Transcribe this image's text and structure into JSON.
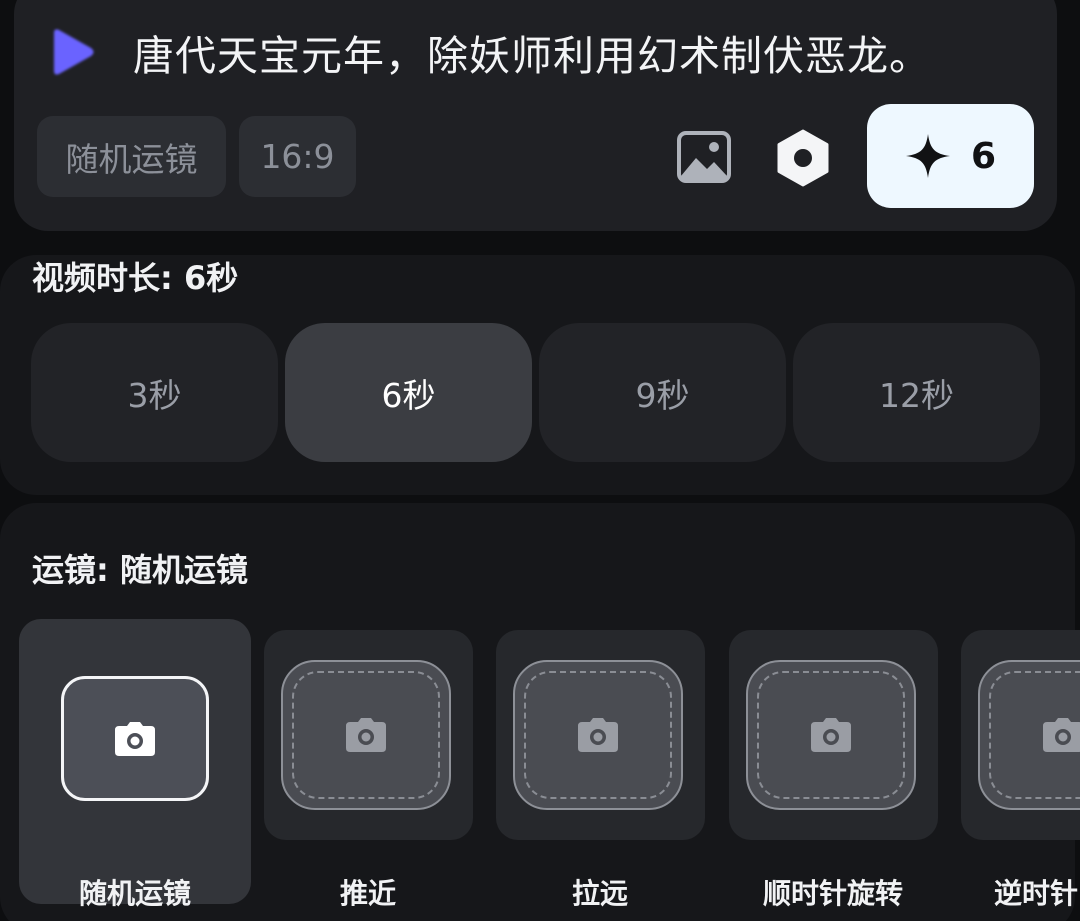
{
  "prompt": {
    "text": "唐代天宝元年，除妖师利用幻术制伏恶龙。",
    "camera_chip": "随机运镜",
    "ratio_chip": "16:9",
    "generate_credits": "6",
    "accent_color": "#6b63ff"
  },
  "duration": {
    "title": "视频时长: 6秒",
    "options": [
      "3秒",
      "6秒",
      "9秒",
      "12秒"
    ],
    "selected": "6秒"
  },
  "camera": {
    "title": "运镜: 随机运镜",
    "options": [
      "随机运镜",
      "推近",
      "拉远",
      "顺时针旋转",
      "逆时针"
    ],
    "selected": "随机运镜"
  }
}
